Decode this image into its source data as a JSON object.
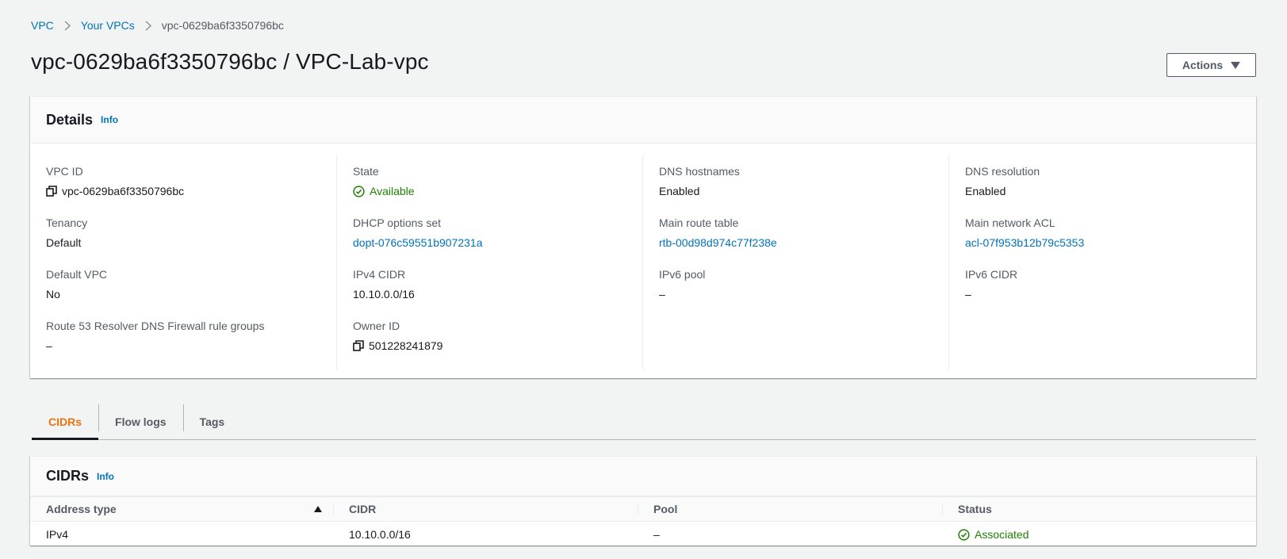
{
  "breadcrumb": {
    "vpc": "VPC",
    "your_vpcs": "Your VPCs",
    "current": "vpc-0629ba6f3350796bc"
  },
  "title": "vpc-0629ba6f3350796bc / VPC-Lab-vpc",
  "actions_label": "Actions",
  "details": {
    "heading": "Details",
    "info": "Info",
    "fields": {
      "vpc_id": {
        "label": "VPC ID",
        "value": "vpc-0629ba6f3350796bc"
      },
      "tenancy": {
        "label": "Tenancy",
        "value": "Default"
      },
      "default_vpc": {
        "label": "Default VPC",
        "value": "No"
      },
      "route53": {
        "label": "Route 53 Resolver DNS Firewall rule groups",
        "value": "–"
      },
      "state": {
        "label": "State",
        "value": "Available"
      },
      "dhcp": {
        "label": "DHCP options set",
        "value": "dopt-076c59551b907231a"
      },
      "ipv4_cidr": {
        "label": "IPv4 CIDR",
        "value": "10.10.0.0/16"
      },
      "owner_id": {
        "label": "Owner ID",
        "value": "501228241879"
      },
      "dns_hostnames": {
        "label": "DNS hostnames",
        "value": "Enabled"
      },
      "main_route_table": {
        "label": "Main route table",
        "value": "rtb-00d98d974c77f238e"
      },
      "ipv6_pool": {
        "label": "IPv6 pool",
        "value": "–"
      },
      "dns_resolution": {
        "label": "DNS resolution",
        "value": "Enabled"
      },
      "main_network_acl": {
        "label": "Main network ACL",
        "value": "acl-07f953b12b79c5353"
      },
      "ipv6_cidr": {
        "label": "IPv6 CIDR",
        "value": "–"
      }
    }
  },
  "tabs": [
    "CIDRs",
    "Flow logs",
    "Tags"
  ],
  "cidrs": {
    "heading": "CIDRs",
    "info": "Info",
    "columns": [
      "Address type",
      "CIDR",
      "Pool",
      "Status"
    ],
    "rows": [
      {
        "address_type": "IPv4",
        "cidr": "10.10.0.0/16",
        "pool": "–",
        "status": "Associated"
      }
    ]
  },
  "colors": {
    "link": "#0073bb",
    "success": "#1d8102",
    "active_tab": "#ec7211"
  }
}
